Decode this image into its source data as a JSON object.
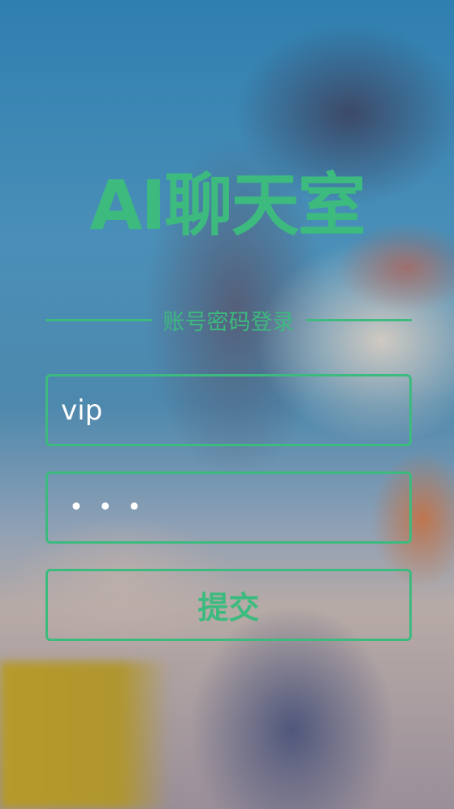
{
  "header": {
    "title": "AI聊天室",
    "subtitle": "账号密码登录"
  },
  "form": {
    "username_value": "vip",
    "password_mask": "•••",
    "submit_label": "提交"
  },
  "colors": {
    "accent": "#3dba7e"
  }
}
